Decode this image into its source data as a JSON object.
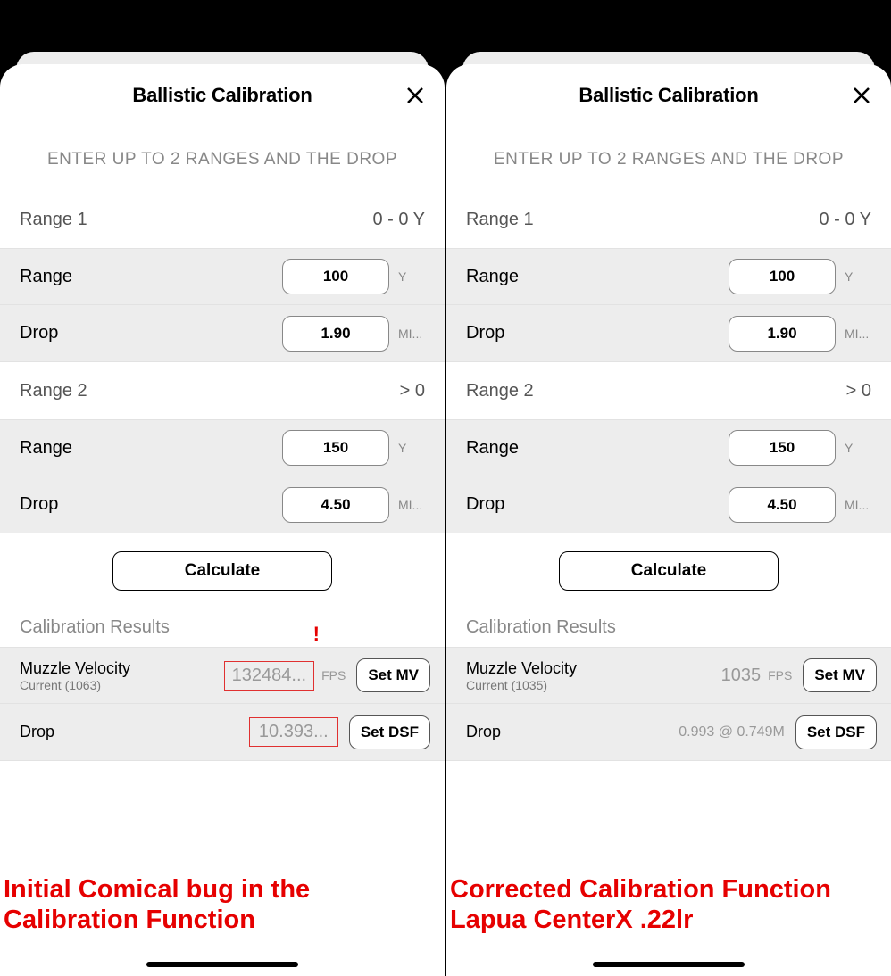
{
  "common": {
    "title": "Ballistic Calibration",
    "instruction": "ENTER UP TO 2 RANGES AND THE DROP",
    "range1_label": "Range 1",
    "range2_label": "Range 2",
    "range_label": "Range",
    "drop_label": "Drop",
    "calculate": "Calculate",
    "results_header": "Calibration Results",
    "mv_label": "Muzzle Velocity",
    "set_mv": "Set MV",
    "set_dsf": "Set DSF",
    "unit_y": "Y",
    "unit_mil": "MI...",
    "unit_fps": "FPS"
  },
  "left": {
    "range1_meta": "0 - 0 Y",
    "range1_range": "100",
    "range1_drop": "1.90",
    "range2_meta": "> 0",
    "range2_range": "150",
    "range2_drop": "4.50",
    "mv_current": "Current (1063)",
    "mv_value": "132484...",
    "drop_value": "10.393...",
    "excl": "!",
    "caption": "Initial Comical bug in the Calibration Function"
  },
  "right": {
    "range1_meta": "0 - 0 Y",
    "range1_range": "100",
    "range1_drop": "1.90",
    "range2_meta": "> 0",
    "range2_range": "150",
    "range2_drop": "4.50",
    "mv_current": "Current (1035)",
    "mv_value": "1035",
    "drop_value": "0.993 @ 0.749M",
    "caption": "Corrected Calibration Function Lapua CenterX .22lr"
  }
}
